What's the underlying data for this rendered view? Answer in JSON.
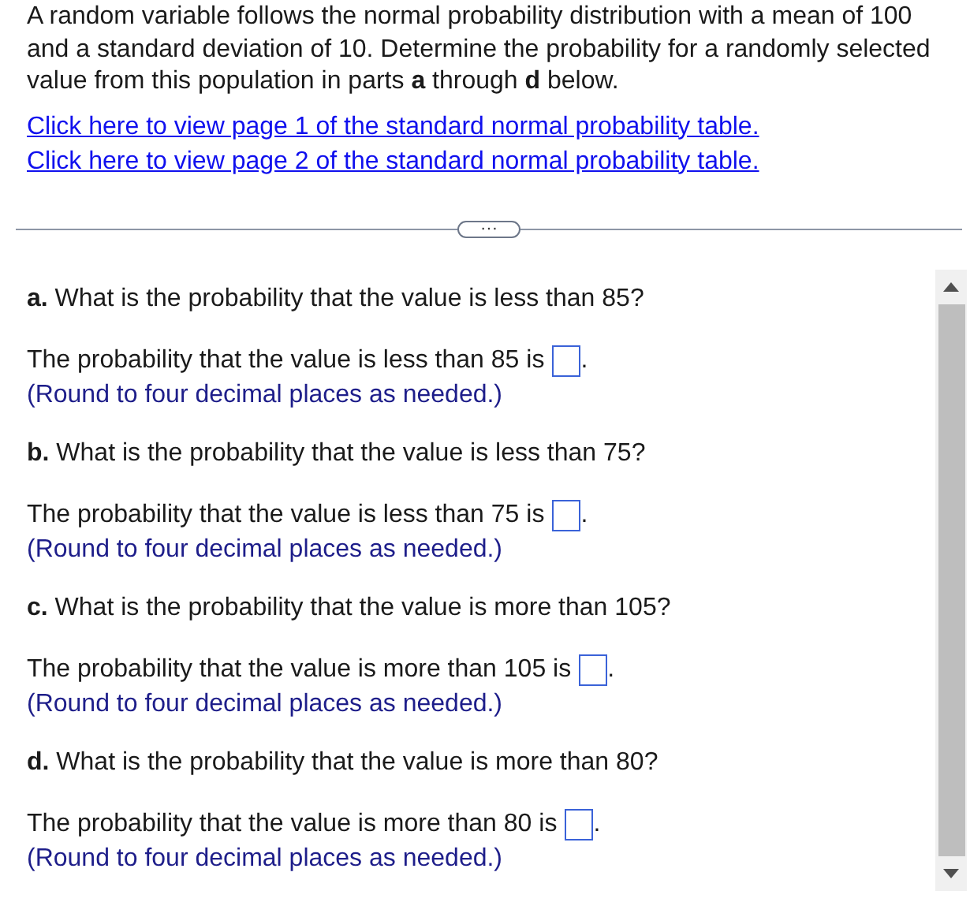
{
  "intro": "A random variable follows the normal probability distribution with a mean of 100 and a standard deviation of 10. Determine the probability for a randomly selected value from this population in parts **a** through **d** below.",
  "links": [
    "Click here to view page 1 of the standard normal probability table.",
    "Click here to view page 2 of the standard normal probability table."
  ],
  "divider_button": "···",
  "parts": [
    {
      "question": "**a.** What is the probability that the value is less than 85?",
      "answer_prefix": "The probability that the value is less than 85 is",
      "answer_suffix": ".",
      "note": "(Round to four decimal places as needed.)"
    },
    {
      "question": "**b.** What is the probability that the value is less than 75?",
      "answer_prefix": "The probability that the value is less than 75 is",
      "answer_suffix": ".",
      "note": "(Round to four decimal places as needed.)"
    },
    {
      "question": "**c.** What is the probability that the value is more than 105?",
      "answer_prefix": "The probability that the value is more than 105 is",
      "answer_suffix": ".",
      "note": "(Round to four decimal places as needed.)"
    },
    {
      "question": "**d.** What is the probability that the value is more than 80?",
      "answer_prefix": "The probability that the value is more than 80 is",
      "answer_suffix": ".",
      "note": "(Round to four decimal places as needed.)"
    }
  ]
}
